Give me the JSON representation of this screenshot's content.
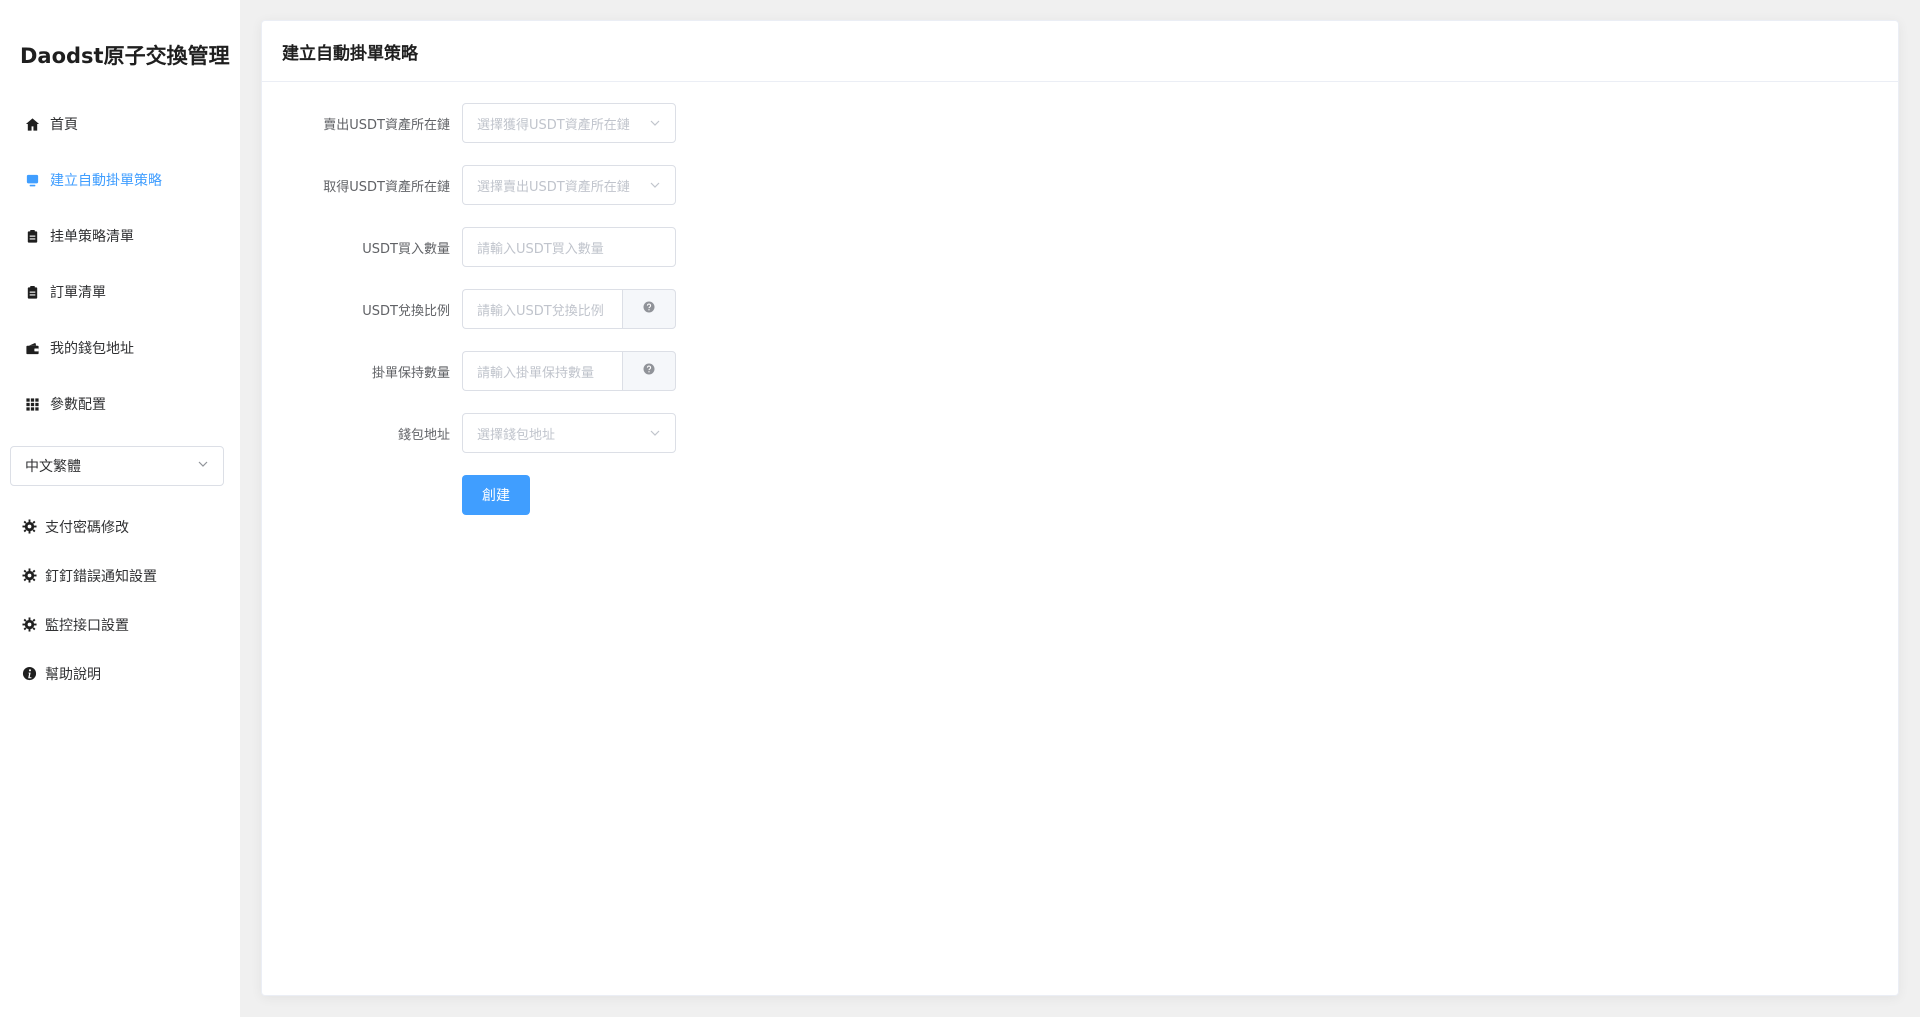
{
  "app": {
    "title": "Daodst原子交換管理"
  },
  "nav": {
    "items": [
      {
        "label": "首頁",
        "icon": "home-icon",
        "active": false
      },
      {
        "label": "建立自動掛單策略",
        "icon": "monitor-icon",
        "active": true
      },
      {
        "label": "挂单策略清單",
        "icon": "clipboard-icon",
        "active": false
      },
      {
        "label": "訂單清單",
        "icon": "clipboard-icon",
        "active": false
      },
      {
        "label": "我的錢包地址",
        "icon": "wallet-icon",
        "active": false
      },
      {
        "label": "參數配置",
        "icon": "grid-icon",
        "active": false
      }
    ]
  },
  "language": {
    "selected": "中文繁體"
  },
  "settings": {
    "items": [
      {
        "label": "支付密碼修改",
        "icon": "gear-icon"
      },
      {
        "label": "釘釘錯誤通知設置",
        "icon": "gear-icon"
      },
      {
        "label": "監控接口設置",
        "icon": "gear-icon"
      },
      {
        "label": "幫助說明",
        "icon": "info-icon"
      }
    ]
  },
  "page": {
    "title": "建立自動掛單策略",
    "form": {
      "sell_chain": {
        "label": "賣出USDT資產所在鏈",
        "placeholder": "選擇獲得USDT資產所在鏈"
      },
      "get_chain": {
        "label": "取得USDT資產所在鏈",
        "placeholder": "選擇賣出USDT資產所在鏈"
      },
      "buy_amount": {
        "label": "USDT買入數量",
        "placeholder": "請輸入USDT買入數量"
      },
      "exchange_ratio": {
        "label": "USDT兌換比例",
        "placeholder": "請輸入USDT兌換比例"
      },
      "keep_amount": {
        "label": "掛單保持數量",
        "placeholder": "請輸入掛單保持數量"
      },
      "wallet": {
        "label": "錢包地址",
        "placeholder": "選擇錢包地址"
      },
      "submit_label": "創建"
    }
  },
  "colors": {
    "accent": "#409eff",
    "background": "#f0f0f0"
  }
}
